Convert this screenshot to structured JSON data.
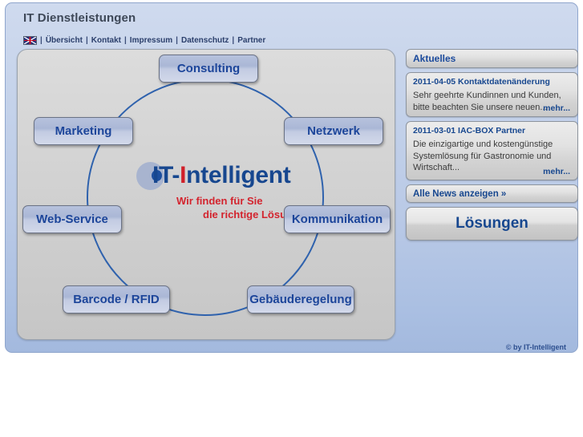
{
  "header": {
    "title": "IT Dienstleistungen",
    "flag_icon": "uk-flag-icon",
    "nav": [
      {
        "label": "Übersicht"
      },
      {
        "label": "Kontakt"
      },
      {
        "label": "Impressum"
      },
      {
        "label": "Datenschutz"
      },
      {
        "label": "Partner"
      }
    ],
    "separator": "|"
  },
  "logo": {
    "prefix": "IT-",
    "accent_letter": "I",
    "suffix": "ntelligent",
    "tagline_line1": "Wir finden für Sie",
    "tagline_line2": "die richtige Lösung.",
    "accent_color": "#d0202a",
    "text_color": "#17478f"
  },
  "hub": {
    "nodes": [
      {
        "label": "Consulting"
      },
      {
        "label": "Netzwerk"
      },
      {
        "label": "Marketing"
      },
      {
        "label": "Kommunikation"
      },
      {
        "label": "Web-Service"
      },
      {
        "label": "Barcode / RFID"
      },
      {
        "label": "Gebäuderegelung"
      }
    ],
    "circle_color": "#2f62ad"
  },
  "sidebar": {
    "heading": "Aktuelles",
    "news": [
      {
        "title": "2011-04-05 Kontaktdatenänderung",
        "body": "Sehr geehrte Kundinnen und Kunden, bitte beachten Sie unsere neuen...",
        "more_label": "mehr..."
      },
      {
        "title": "2011-03-01 IAC-BOX Partner",
        "body": "Die einzigartige und kostengünstige Systemlösung für Gastronomie und Wirtschaft...",
        "more_label": "mehr..."
      }
    ],
    "all_news_label": "Alle News anzeigen »",
    "solutions_label": "Lösungen"
  },
  "footer": {
    "copyright": "© by IT-Intelligent"
  }
}
